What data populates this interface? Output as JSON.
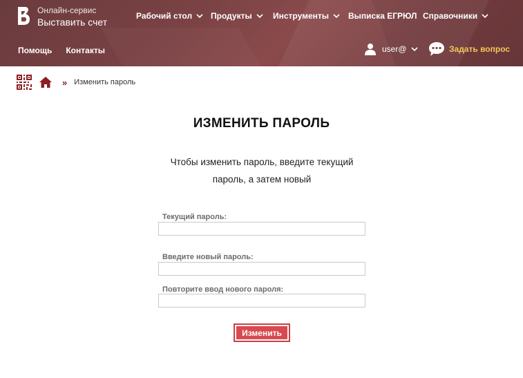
{
  "brand": {
    "small": "Онлайн-сервис",
    "big": "Выставить счет",
    "logo_icon": "brand-logo-icon"
  },
  "nav": {
    "items": [
      {
        "label": "Рабочий стол",
        "has_dropdown": true
      },
      {
        "label": "Продукты",
        "has_dropdown": true
      },
      {
        "label": "Инструменты",
        "has_dropdown": true
      },
      {
        "label": "Выписка ЕГРЮЛ",
        "has_dropdown": false
      },
      {
        "label": "Справочники",
        "has_dropdown": true
      }
    ]
  },
  "subnav": {
    "help": "Помощь",
    "contacts": "Контакты"
  },
  "user": {
    "name": "user@",
    "icon": "user-icon"
  },
  "ask": {
    "label": "Задать вопрос",
    "icon": "chat-bubble-icon"
  },
  "breadcrumb": {
    "separator": "»",
    "current": "Изменить пароль"
  },
  "main": {
    "title": "ИЗМЕНИТЬ ПАРОЛЬ",
    "intro_line1": "Чтобы изменить пароль, введите текущий",
    "intro_line2": "пароль, а затем новый",
    "fields": [
      {
        "label": "Текущий пароль:",
        "value": ""
      },
      {
        "label": "Введите новый пароль:",
        "value": ""
      },
      {
        "label": "Повторите ввод нового пароля:",
        "value": ""
      }
    ],
    "submit_label": "Изменить"
  },
  "colors": {
    "header_bg": "#7a4244",
    "accent": "#d84a4f",
    "ask_link": "#f3c65a",
    "breadcrumb_sep": "#8b1f24"
  }
}
